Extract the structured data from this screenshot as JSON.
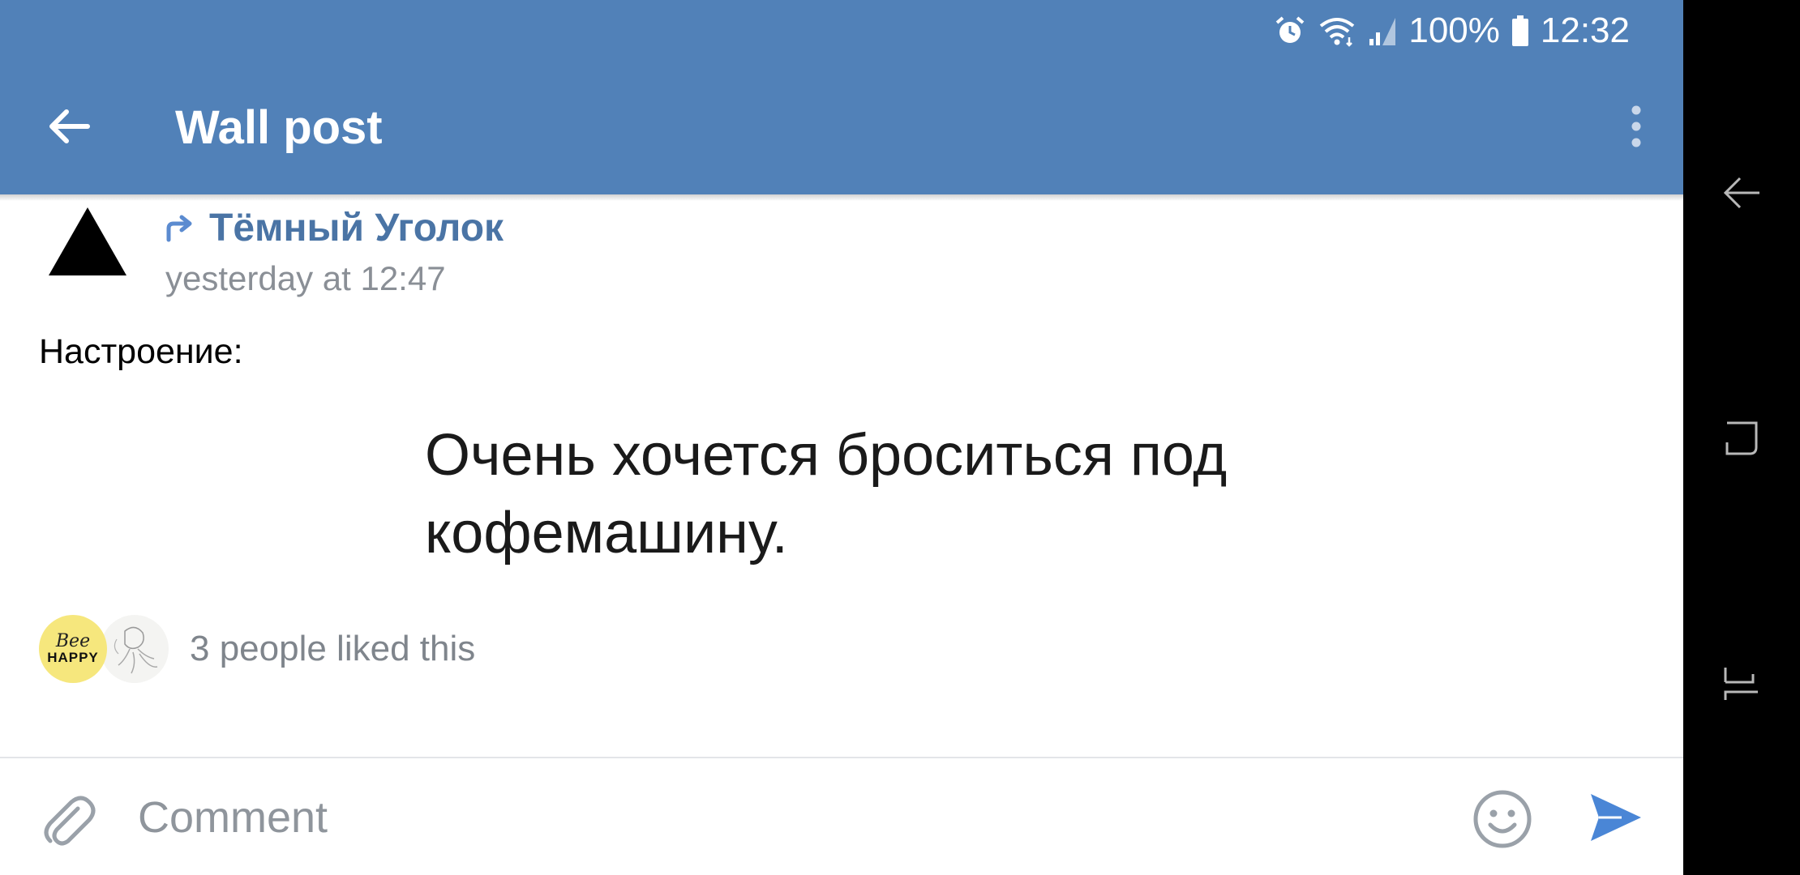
{
  "status_bar": {
    "battery": "100%",
    "time": "12:32",
    "icons": [
      "alarm-icon",
      "wifi-icon",
      "signal-icon",
      "battery-icon"
    ]
  },
  "header": {
    "title": "Wall post",
    "background_color": "#5181b8",
    "icons": [
      "back-arrow-icon",
      "more-vert-icon"
    ]
  },
  "post": {
    "author": "Тёмный Уголок",
    "time": "yesterday at 12:47",
    "text": "Настроение:",
    "image_caption": "Очень хочется броситься под\nкофемашину.",
    "author_color": "#4a74a5",
    "icons": [
      "repost-icon",
      "triangle-avatar-icon"
    ]
  },
  "likes": {
    "text": "3 people liked this",
    "avatar_1_text": {
      "line1": "Bee",
      "line2": "HAPPY"
    }
  },
  "comment_bar": {
    "placeholder": "Comment",
    "icons": [
      "paperclip-icon",
      "emoji-icon",
      "send-icon"
    ],
    "send_color": "#4a86d6"
  },
  "nav_bar": {
    "icons": [
      "nav-back-icon",
      "nav-recents-icon",
      "nav-home-icon"
    ]
  }
}
